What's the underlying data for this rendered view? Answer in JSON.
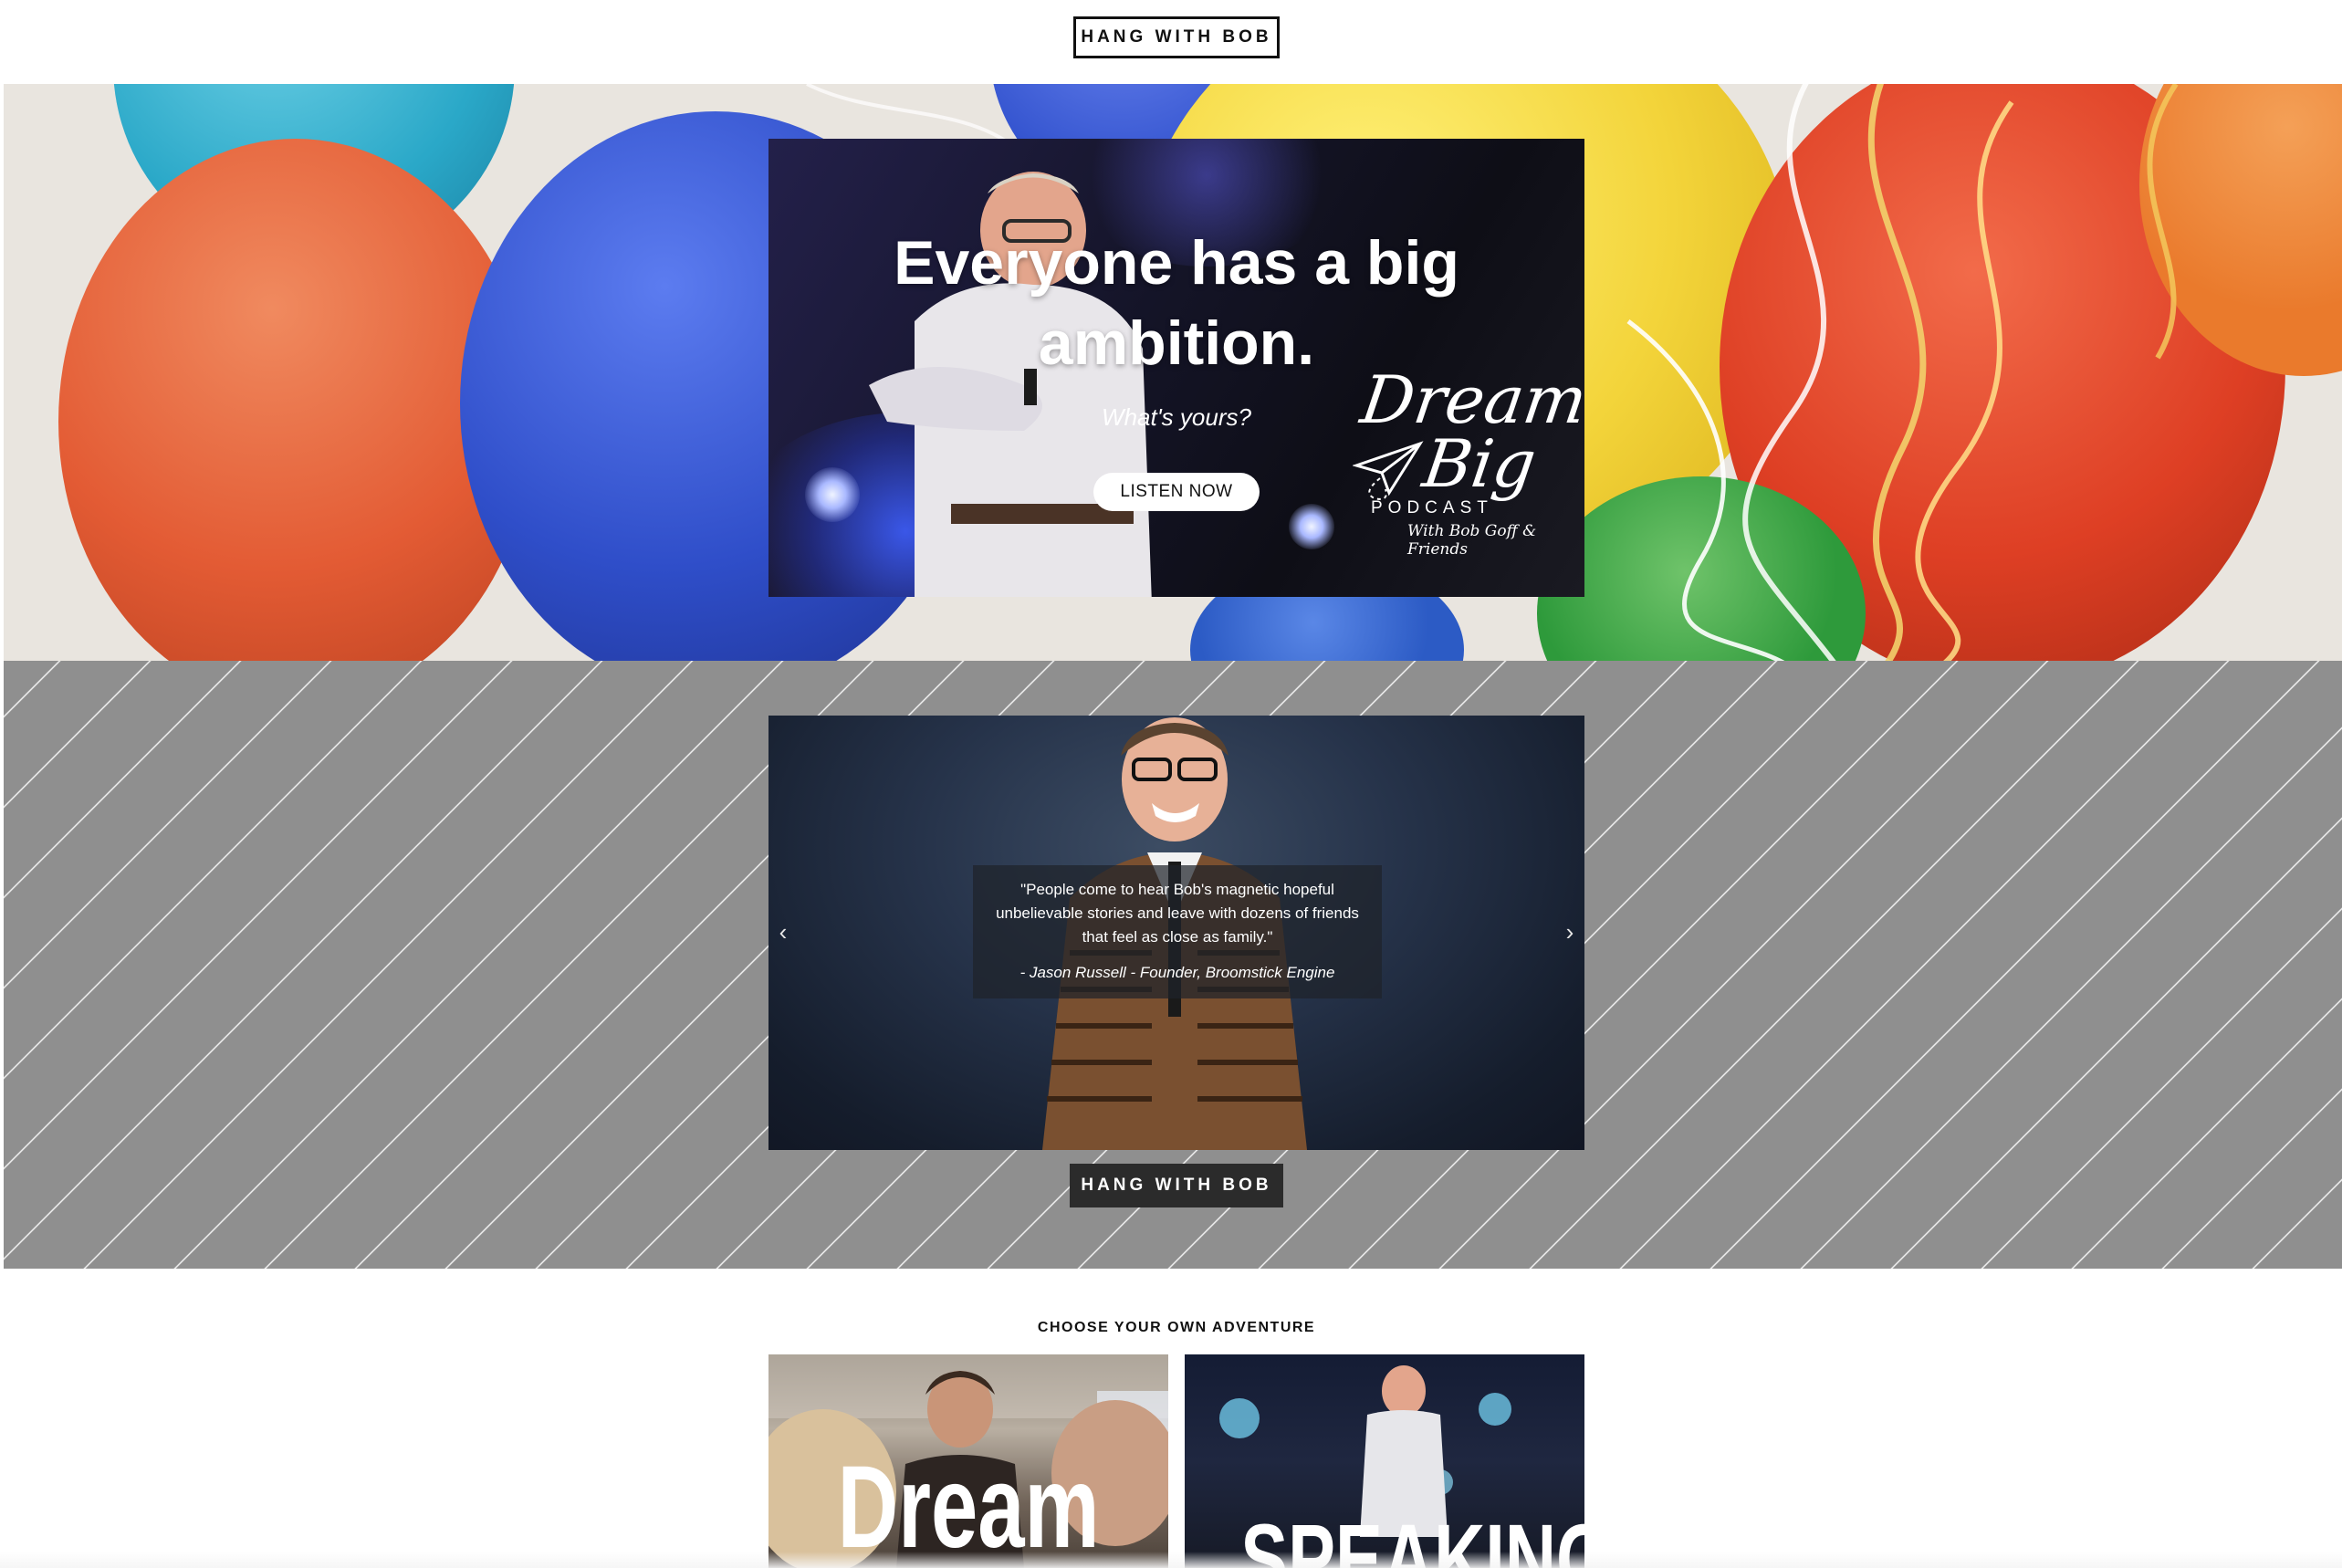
{
  "header": {
    "button_label": "HANG WITH BOB"
  },
  "hero": {
    "headline": "Everyone has a big ambition.",
    "subheadline": "What's yours?",
    "cta_label": "LISTEN NOW",
    "logo": {
      "word1": "Dream",
      "word2": "Big",
      "podcast": "PODCAST",
      "tagline": "With Bob Goff & Friends"
    }
  },
  "testimonial": {
    "quote": "\"People come to hear Bob's magnetic hopeful unbelievable stories and leave with dozens of friends that feel as close as family.\"",
    "author": "- Jason Russell - Founder, Broomstick Engine",
    "prev_icon": "chevron-left-icon",
    "next_icon": "chevron-right-icon",
    "button_label": "HANG WITH BOB"
  },
  "adventure": {
    "title": "CHOOSE YOUR OWN ADVENTURE",
    "cards": [
      {
        "label": "Dream"
      },
      {
        "label": "SPEAKING"
      }
    ]
  },
  "colors": {
    "testimonial_bg": "#8f8f8f",
    "button_dark": "#2b2b2b",
    "promo_bg": "#141427"
  }
}
